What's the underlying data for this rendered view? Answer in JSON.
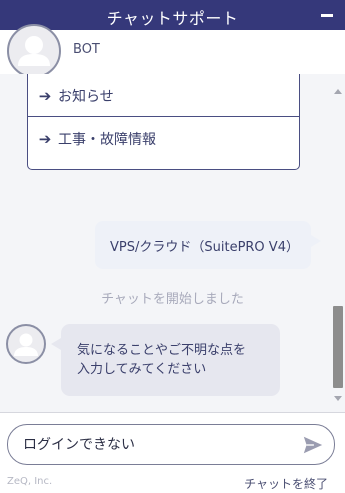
{
  "header": {
    "title": "チャットサポート",
    "minimize_icon": "minimize-icon",
    "bg_color": "#35387a"
  },
  "bot": {
    "name": "BOT",
    "avatar_icon": "user-avatar-icon"
  },
  "menu": {
    "items": [
      {
        "label": "お知らせ",
        "icon": "arrow-right-icon"
      },
      {
        "label": "工事・故障情報",
        "icon": "arrow-right-icon"
      }
    ]
  },
  "messages": {
    "user_selection": "VPS/クラウド（SuitePRO V4）",
    "system_notice": "チャットを開始しました",
    "bot_prompt_line1": "気になることやご不明な点を",
    "bot_prompt_line2": "入力してみてください"
  },
  "input": {
    "value": "ログインできない",
    "send_icon": "send-icon"
  },
  "footer": {
    "brand": "ZeQ, Inc.",
    "end_chat_label": "チャットを終了"
  }
}
